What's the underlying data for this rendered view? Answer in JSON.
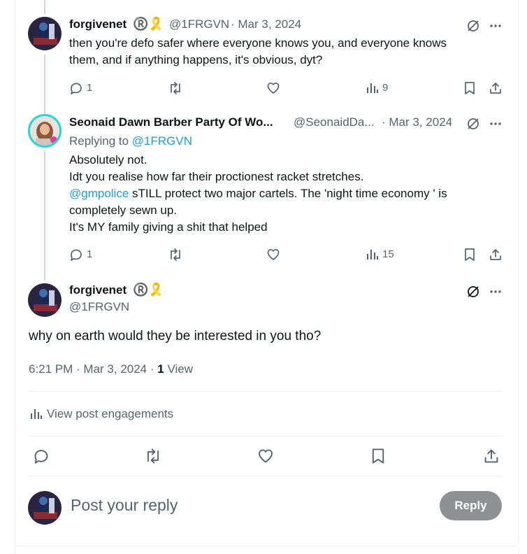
{
  "posts": [
    {
      "author_name": "forgivenet",
      "author_badges": "®️🎗️",
      "handle": "@1FRGVN",
      "date": "· Mar 3, 2024",
      "lines": [
        "then you're defo safer where everyone knows you, and everyone knows",
        "them, and if anything happens, it's obvious, dyt?"
      ],
      "replies": "1",
      "views": "9"
    },
    {
      "author_name": "Seonaid Dawn Barber Party Of Wo...",
      "handle": "@SeonaidDa...",
      "date": "· Mar 3, 2024",
      "replying_prefix": "Replying to ",
      "replying_handle": "@1FRGVN",
      "line1": "Absolutely not.",
      "line2": "Idt you realise how far their proctionest racket stretches.",
      "line3_mention": "@gmpolice",
      "line3_rest": " sTILL protect two major cartels. The 'night time economy ' is",
      "line4": "completely sewn up.",
      "line5": "It's MY family giving a shit that helped",
      "replies": "1",
      "views": "15"
    }
  ],
  "main_post": {
    "author_name": "forgivenet",
    "author_badges": "®️🎗️",
    "handle": "@1FRGVN",
    "text": "why on earth would they be interested in you tho?",
    "time": "6:21 PM · Mar 3, 2024 · ",
    "view_count": "1",
    "view_label": " View",
    "engagements_label": "View post engagements"
  },
  "compose": {
    "placeholder": "Post your reply",
    "reply_button": "Reply"
  },
  "icons": [
    "grok-icon",
    "more-icon",
    "reply-icon",
    "retweet-icon",
    "like-icon",
    "views-icon",
    "bookmark-icon",
    "share-icon"
  ],
  "colors": {
    "link": "#1d9bf0",
    "muted": "#536471",
    "thread_line": "#cfd9de",
    "reply_button": "#8e9094"
  }
}
